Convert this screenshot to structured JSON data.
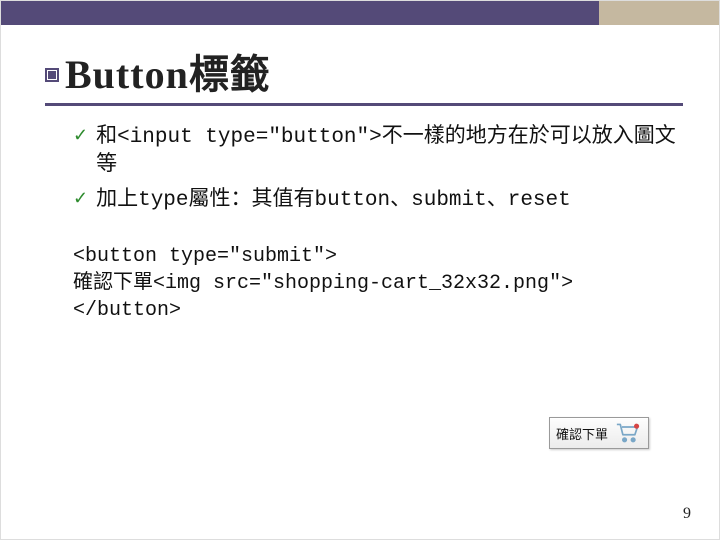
{
  "title": "Button標籤",
  "bullets": [
    "和<input type=\"button\">不一樣的地方在於可以放入圖文等",
    "加上type屬性：其值有button、submit、reset"
  ],
  "code": {
    "line1": "<button type=\"submit\">",
    "line2": "  確認下單<img src=\"shopping-cart_32x32.png\">",
    "line3": "</button>"
  },
  "demo_button_label": "確認下單",
  "icons": {
    "title_bullet": "title-bullet-icon",
    "check": "check-icon",
    "cart": "shopping-cart-icon"
  },
  "page_number": "9"
}
